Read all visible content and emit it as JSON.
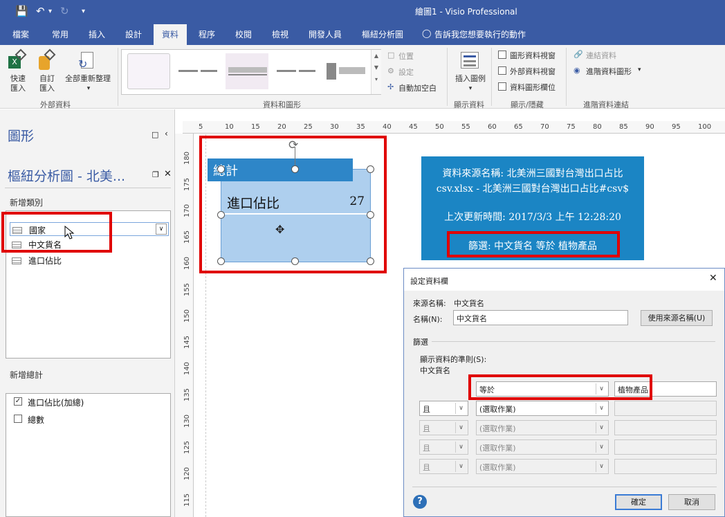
{
  "window": {
    "title": "繪圖1  -  Visio Professional"
  },
  "ribbon_tabs": [
    "檔案",
    "常用",
    "插入",
    "設計",
    "資料",
    "程序",
    "校閱",
    "檢視",
    "開發人員",
    "樞紐分析圖"
  ],
  "tell_me": "告訴我您想要執行的動作",
  "ribbon": {
    "quick_import": "快速\n匯入",
    "custom_import": "自訂\n匯入",
    "refresh_all": "全部重新整理",
    "group_external": "外部資料",
    "position": "位置",
    "settings": "設定",
    "auto_space": "自動加空白",
    "group_data_graphics": "資料和圖形",
    "insert_legend": "插入圖例",
    "group_show_data": "顯示資料",
    "shape_data_window": "圖形資料視窗",
    "external_data_window": "外部資料視窗",
    "data_graphic_fields": "資料圖形欄位",
    "group_show_hide": "顯示/隱藏",
    "link_data": "連結資料",
    "advanced_link": "進階資料圖形",
    "group_advanced": "進階資料連結"
  },
  "shapes_pane": {
    "title": "圖形",
    "pivot_title": "樞紐分析圖 - 北美...",
    "add_category_label": "新增類別",
    "categories": [
      "國家",
      "中文貨名",
      "進口佔比"
    ],
    "add_total_label": "新增總計",
    "totals": [
      {
        "label": "進口佔比(加總)",
        "checked": true
      },
      {
        "label": "總數",
        "checked": false
      }
    ]
  },
  "ruler_h": [
    "5",
    "10",
    "15",
    "20",
    "25",
    "30",
    "35",
    "40",
    "45",
    "50",
    "55",
    "60",
    "65",
    "70",
    "75",
    "80",
    "85",
    "90",
    "95",
    "100"
  ],
  "ruler_v": [
    "180",
    "175",
    "170",
    "165",
    "160",
    "155",
    "150",
    "145",
    "140",
    "135",
    "130",
    "125",
    "120",
    "115"
  ],
  "pivot_node": {
    "header": "總計",
    "label": "進口佔比",
    "value": "27"
  },
  "info_box": {
    "source_line1": "資料來源名稱: 北美洲三國對台灣出口占比",
    "source_line2": "csv.xlsx - 北美洲三國對台灣出口占比#csv$",
    "updated": "上次更新時間: 2017/3/3 上午 12:28:20",
    "filter": "篩選: 中文貨名 等於 植物產品"
  },
  "dialog": {
    "title": "設定資料欄",
    "source_name_label": "來源名稱:",
    "source_name_value": "中文貨名",
    "name_label": "名稱(N):",
    "name_value": "中文貨名",
    "use_source_button": "使用來源名稱(U)",
    "filter_section": "篩選",
    "rule_label": "顯示資料的準則(S):",
    "rule_field": "中文貨名",
    "operator": "等於",
    "filter_value": "植物產品",
    "conjunction": "且",
    "choose_op": "(選取作業)",
    "ok": "確定",
    "cancel": "取消"
  }
}
